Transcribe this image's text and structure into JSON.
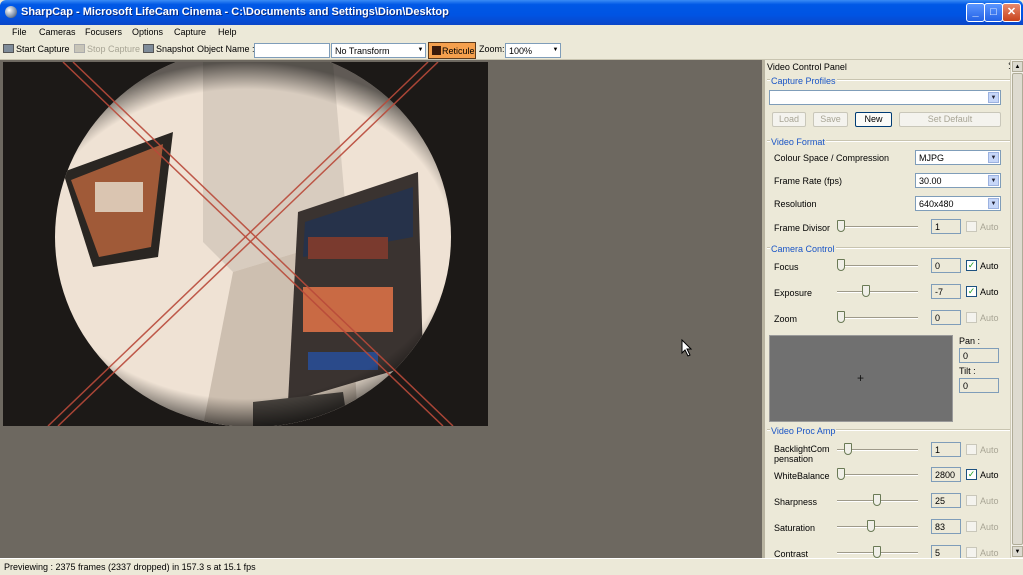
{
  "window": {
    "title": "SharpCap - Microsoft LifeCam Cinema - C:\\Documents and Settings\\Dion\\Desktop"
  },
  "menu": [
    "File",
    "Cameras",
    "Focusers",
    "Options",
    "Capture",
    "Help"
  ],
  "toolbar": {
    "start_capture": "Start Capture",
    "stop_capture": "Stop Capture",
    "snapshot": "Snapshot",
    "object_name_label": "Object Name :",
    "object_name_value": "",
    "transform": "No Transform",
    "reticule": "Reticule",
    "zoom_label": "Zoom:",
    "zoom_value": "100%"
  },
  "panel": {
    "title": "Video Control Panel",
    "pin": "ᕥ",
    "capture_profiles": {
      "title": "Capture Profiles",
      "value": "",
      "load": "Load",
      "save": "Save",
      "new": "New",
      "set_default": "Set Default"
    },
    "video_format": {
      "title": "Video Format",
      "colour_space_label": "Colour Space / Compression",
      "colour_space_value": "MJPG",
      "frame_rate_label": "Frame Rate (fps)",
      "frame_rate_value": "30.00",
      "resolution_label": "Resolution",
      "resolution_value": "640x480",
      "frame_divisor_label": "Frame Divisor",
      "frame_divisor_value": "1",
      "frame_divisor_level": 0.0
    },
    "camera_control": {
      "title": "Camera Control",
      "focus_label": "Focus",
      "focus_value": "0",
      "focus_level": 0.0,
      "exposure_label": "Exposure",
      "exposure_value": "-7",
      "exposure_level": 0.35,
      "zoom_label": "Zoom",
      "zoom_value": "0",
      "zoom_level": 0.0,
      "pan_label": "Pan :",
      "pan_value": "0",
      "tilt_label": "Tilt :",
      "tilt_value": "0",
      "auto_label": "Auto"
    },
    "proc_amp": {
      "title": "Video Proc Amp",
      "backlight_label": "BacklightCom pensation",
      "backlight_value": "1",
      "backlight_level": 0.1,
      "whitebalance_label": "WhiteBalance",
      "whitebalance_value": "2800",
      "whitebalance_level": 0.0,
      "sharpness_label": "Sharpness",
      "sharpness_value": "25",
      "sharpness_level": 0.5,
      "saturation_label": "Saturation",
      "saturation_value": "83",
      "saturation_level": 0.42,
      "contrast_label": "Contrast",
      "contrast_value": "5",
      "contrast_level": 0.5
    }
  },
  "status": "Previewing : 2375 frames (2337 dropped) in 157.3 s at 15.1 fps"
}
